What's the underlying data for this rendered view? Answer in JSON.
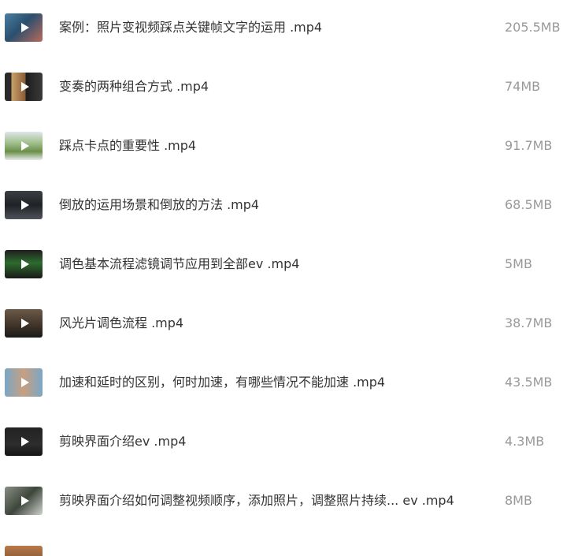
{
  "files": [
    {
      "name": "案例：照片变视频踩点关键帧文字的运用 .mp4",
      "size": "205.5MB",
      "thumbnail_icon": "play-icon"
    },
    {
      "name": "变奏的两种组合方式 .mp4",
      "size": "74MB",
      "thumbnail_icon": "play-icon"
    },
    {
      "name": "踩点卡点的重要性 .mp4",
      "size": "91.7MB",
      "thumbnail_icon": "play-icon"
    },
    {
      "name": "倒放的运用场景和倒放的方法 .mp4",
      "size": "68.5MB",
      "thumbnail_icon": "play-icon"
    },
    {
      "name": "调色基本流程滤镜调节应用到全部ev .mp4",
      "size": "5MB",
      "thumbnail_icon": "play-icon"
    },
    {
      "name": "风光片调色流程 .mp4",
      "size": "38.7MB",
      "thumbnail_icon": "play-icon"
    },
    {
      "name": "加速和延时的区别，何时加速，有哪些情况不能加速 .mp4",
      "size": "43.5MB",
      "thumbnail_icon": "play-icon"
    },
    {
      "name": "剪映界面介绍ev .mp4",
      "size": "4.3MB",
      "thumbnail_icon": "play-icon"
    },
    {
      "name": "剪映界面介绍如何调整视频顺序，添加照片，调整照片持续... ev .mp4",
      "size": "8MB",
      "thumbnail_icon": "play-icon"
    }
  ],
  "colors": {
    "filename_text": "#333333",
    "size_text": "#999999",
    "background": "#ffffff"
  }
}
